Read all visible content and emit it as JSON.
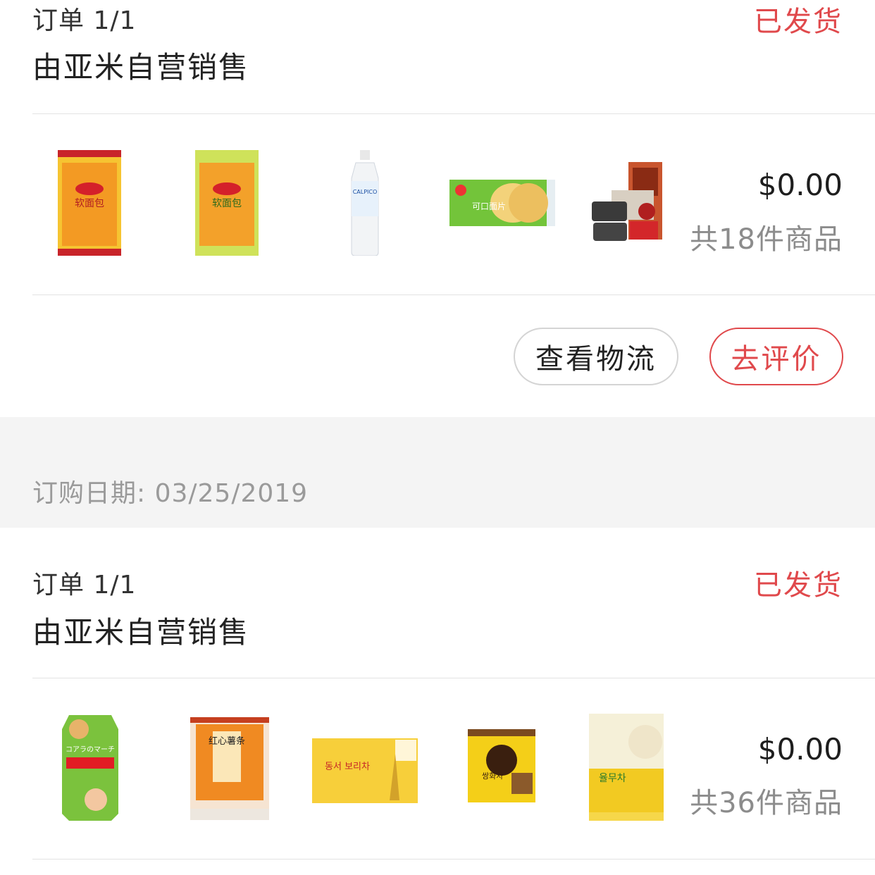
{
  "orders": [
    {
      "order_label": "订单 1/1",
      "seller": "由亚米自营销售",
      "status": "已发货",
      "price": "$0.00",
      "item_count": "共18件商品",
      "thumbs": [
        {
          "name": "达利园软面包(原味)",
          "text": "软面包"
        },
        {
          "name": "达利园软面包(绿)",
          "text": "软面包"
        },
        {
          "name": "CALPICO 饮料",
          "text": "CALPICO"
        },
        {
          "name": "可口面包片",
          "text": "可口面片"
        },
        {
          "name": "零食礼包",
          "text": ""
        }
      ],
      "buttons": {
        "logistics": "查看物流",
        "review": "去评价"
      }
    },
    {
      "order_label": "订单 1/1",
      "seller": "由亚米自营销售",
      "status": "已发货",
      "price": "$0.00",
      "item_count": "共36件商品",
      "thumbs": [
        {
          "name": "小熊饼干",
          "text": "コアラのマーチ"
        },
        {
          "name": "红心薯条",
          "text": "红心薯条"
        },
        {
          "name": "东西大麦茶",
          "text": "동서 보리차"
        },
        {
          "name": "双和茶",
          "text": "쌍화차"
        },
        {
          "name": "薏米茶",
          "text": "율무차"
        }
      ]
    }
  ],
  "order_date": "订购日期: 03/25/2019",
  "colors": {
    "accent": "#e0494c",
    "band": "#f4f4f4",
    "divider": "#e3e3e3"
  }
}
